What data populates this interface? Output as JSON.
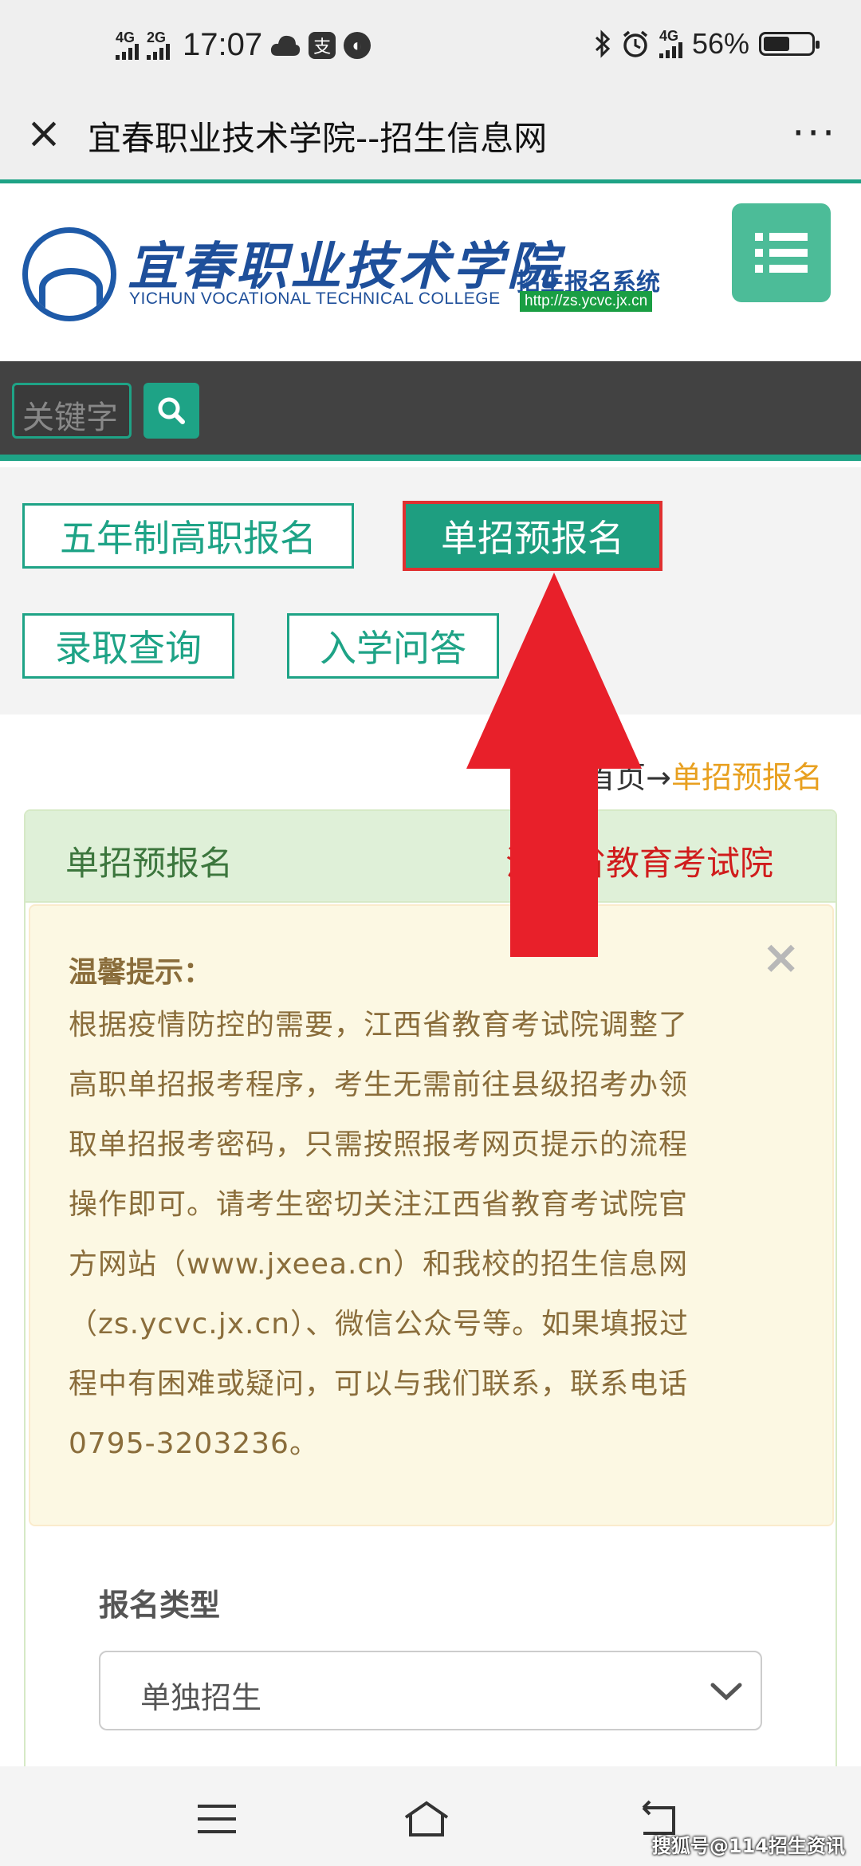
{
  "status_bar": {
    "network1": "4G",
    "network2": "2G",
    "time": "17:07",
    "app_icon_label": "支",
    "network3": "4G",
    "battery_percent": "56%",
    "battery_level": 0.56
  },
  "title_bar": {
    "title": "宜春职业技术学院--招生信息网",
    "more": "···"
  },
  "header": {
    "school_name_cn": "宜春职业技术学院",
    "school_name_en": "YICHUN VOCATIONAL TECHNICAL COLLEGE",
    "system_name": "招生报名系统",
    "url": "http://zs.ycvc.jx.cn"
  },
  "search": {
    "placeholder": "关键字"
  },
  "nav": {
    "btn_five_year": "五年制高职报名",
    "btn_single_enroll": "单招预报名",
    "btn_admission_query": "录取查询",
    "btn_qa": "入学问答"
  },
  "breadcrumb": {
    "home": "首页",
    "sep": "→",
    "current": "单招预报名"
  },
  "panel": {
    "title": "单招预报名",
    "org": "江西省教育考试院"
  },
  "alert": {
    "heading": "温馨提示：",
    "close": "×",
    "lines": [
      "根据疫情防控的需要，江西省教育考试院调整了",
      "高职单招报考程序，考生无需前往县级招考办领",
      "取单招报考密码，只需按照报考网页提示的流程",
      "操作即可。请考生密切关注江西省教育考试院官",
      "方网站（www.jxeea.cn）和我校的招生信息网",
      "（zs.ycvc.jx.cn）、微信公众号等。如果填报过",
      "程中有困难或疑问，可以与我们联系，联系电话",
      "0795-3203236。"
    ]
  },
  "form": {
    "type_label": "报名类型",
    "type_value": "单独招生"
  },
  "watermark": "搜狐号@114招生资讯",
  "colors": {
    "accent": "#1ea386",
    "highlight_border": "#e03030",
    "arrow": "#e8202a",
    "alert_text": "#8a6d3b",
    "breadcrumb_current": "#e8a020"
  }
}
